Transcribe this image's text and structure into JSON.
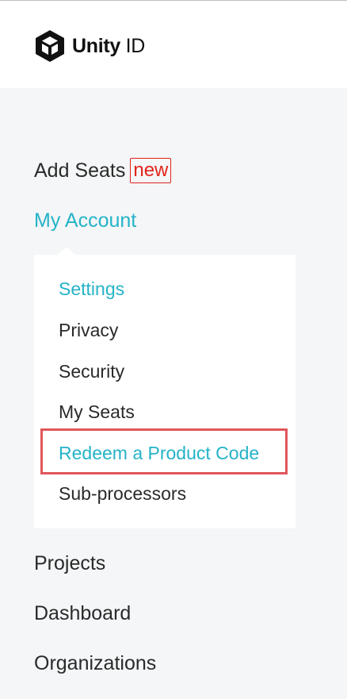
{
  "brand": {
    "name_bold": "Unity",
    "name_light": " ID",
    "icon": "unity-cube-icon"
  },
  "nav": {
    "add_seats": {
      "label": "Add Seats",
      "badge": "new"
    },
    "my_account": {
      "label": "My Account",
      "active": true
    },
    "submenu": [
      {
        "label": "Settings",
        "active": true
      },
      {
        "label": "Privacy"
      },
      {
        "label": "Security"
      },
      {
        "label": "My Seats"
      },
      {
        "label": "Redeem a Product Code",
        "active": true,
        "highlighted": true
      },
      {
        "label": "Sub-processors"
      }
    ],
    "projects": {
      "label": "Projects"
    },
    "dashboard": {
      "label": "Dashboard"
    },
    "organizations": {
      "label": "Organizations"
    }
  },
  "colors": {
    "accent": "#25b3c8",
    "badge": "#e2231a",
    "highlight": "#e0565b",
    "background": "#f4f6f7"
  }
}
